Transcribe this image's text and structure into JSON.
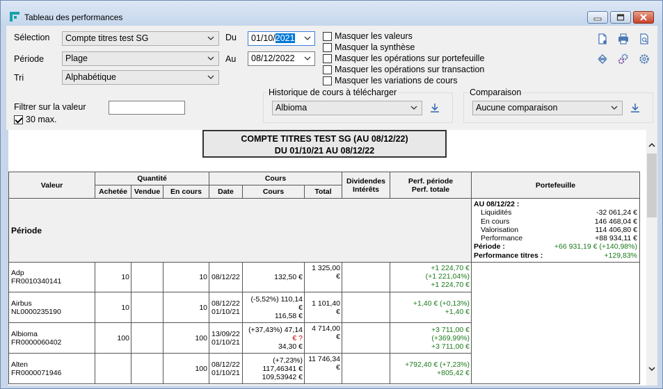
{
  "window": {
    "title": "Tableau des performances"
  },
  "controls": {
    "selection_label": "Sélection",
    "selection_value": "Compte titres test SG",
    "periode_label": "Période",
    "periode_value": "Plage",
    "tri_label": "Tri",
    "tri_value": "Alphabétique",
    "du_label": "Du",
    "du_prefix": "01/10/",
    "du_year": "2021",
    "au_label": "Au",
    "au_value": "08/12/2022",
    "filter_label": "Filtrer sur la valeur",
    "filter_value": "",
    "max_label": "30 max.",
    "checks": [
      {
        "label": "Masquer les valeurs",
        "checked": false
      },
      {
        "label": "Masquer la synthèse",
        "checked": false
      },
      {
        "label": "Masquer les opérations sur portefeuille",
        "checked": false
      },
      {
        "label": "Masquer les opérations sur transaction",
        "checked": false
      },
      {
        "label": "Masquer les variations de cours",
        "checked": false
      }
    ],
    "historique_label": "Historique de cours à télécharger",
    "historique_value": "Albioma",
    "comparaison_label": "Comparaison",
    "comparaison_value": "Aucune comparaison"
  },
  "report": {
    "title_line1": "COMPTE TITRES TEST SG (AU 08/12/22)",
    "title_line2": "DU 01/10/21 AU 08/12/22",
    "headers": {
      "valeur": "Valeur",
      "quantite": "Quantité",
      "achetee": "Achetée",
      "vendue": "Vendue",
      "en_cours": "En cours",
      "cours_group": "Cours",
      "date": "Date",
      "cours": "Cours",
      "total": "Total",
      "dividendes": "Dividendes",
      "interets": "Intérêts",
      "perf_periode": "Perf. période",
      "perf_totale": "Perf. totale",
      "portefeuille": "Portefeuille"
    },
    "periode_label": "Période",
    "portefeuille": {
      "heading": "AU 08/12/22 :",
      "liquidites_label": "Liquidités",
      "liquidites": "-32 061,24 €",
      "en_cours_label": "En cours",
      "en_cours": "146 468,04 €",
      "valorisation_label": "Valorisation",
      "valorisation": "114 406,80 €",
      "performance_label": "Performance",
      "performance": "+88 934,11 €",
      "periode_label": "Période :",
      "periode": "+66 931,19 € (+140,98%)",
      "perf_titres_label": "Performance titres :",
      "perf_titres": "+129,83%"
    },
    "rows": [
      {
        "name": "Adp",
        "isin": "FR0010340141",
        "achetee": "10",
        "vendue": "",
        "en_cours": "10",
        "date1": "08/12/22",
        "date2": "",
        "cours1": "",
        "cours2": "132,50 €",
        "cours3": "",
        "total1": "1 325,00",
        "total2": "€",
        "perf1": "+1 224,70 €",
        "perf2": "(+1 221,04%)",
        "perf3": "+1 224,70 €"
      },
      {
        "name": "Airbus",
        "isin": "NL0000235190",
        "achetee": "10",
        "vendue": "",
        "en_cours": "10",
        "date1": "08/12/22",
        "date2": "01/10/21",
        "cours1": "(-5,52%) 110,14",
        "cours2": "€",
        "cours3": "116,58 €",
        "total1": "1 101,40",
        "total2": "€",
        "perf1": "+1,40 € (+0,13%)",
        "perf2": "+1,40 €",
        "perf3": ""
      },
      {
        "name": "Albioma",
        "isin": "FR0000060402",
        "achetee": "100",
        "vendue": "",
        "en_cours": "100",
        "date1": "13/09/22",
        "date2": "01/10/21",
        "cours1": "(+37,43%) 47,14",
        "cours2": "€ ?",
        "cours3": "34,30 €",
        "total1": "4 714,00",
        "total2": "€",
        "perf1": "+3 711,00 €",
        "perf2": "(+369,99%)",
        "perf3": "+3 711,00 €"
      },
      {
        "name": "Alten",
        "isin": "FR0000071946",
        "achetee": "",
        "vendue": "",
        "en_cours": "100",
        "date1": "08/12/22",
        "date2": "01/10/21",
        "cours1": "(+7,23%)",
        "cours2": "117,46341 €",
        "cours3": "109,53942 €",
        "total1": "11 746,34",
        "total2": "€",
        "perf1": "+792,40 € (+7,23%)",
        "perf2": "+805,42 €",
        "perf3": ""
      }
    ]
  }
}
